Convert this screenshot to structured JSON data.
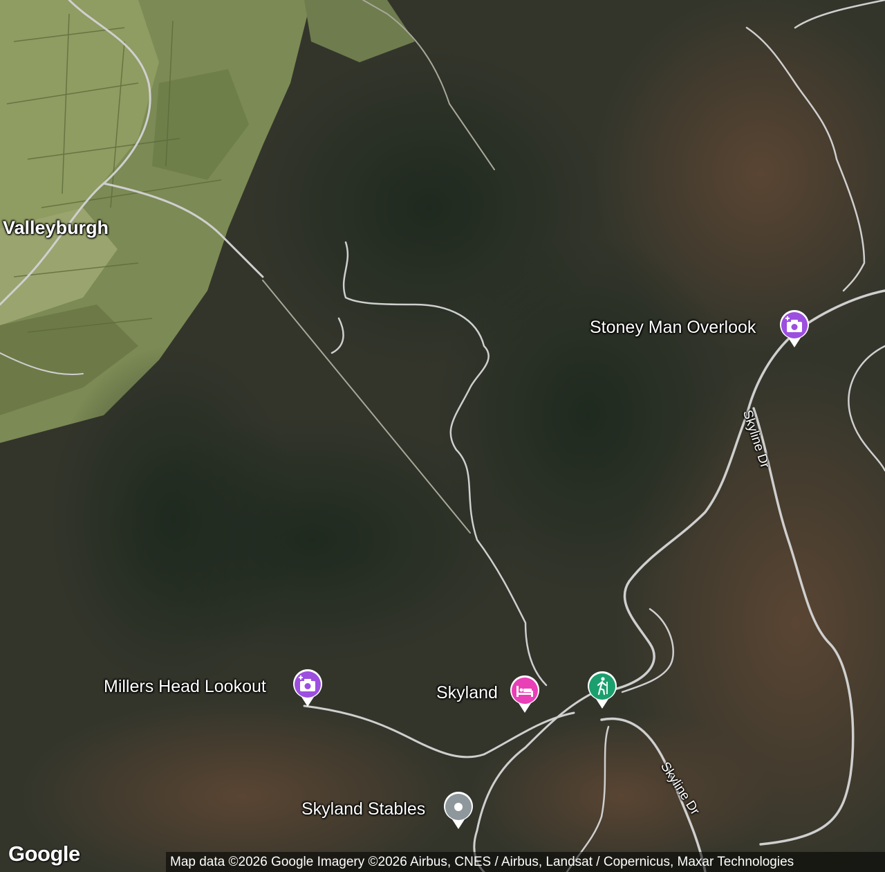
{
  "map": {
    "type": "satellite",
    "colors": {
      "forest_dark": "#2f3429",
      "forest_brown": "#4a3c2e",
      "farmland": "#8a9a5a",
      "road": "#d8d8d8",
      "pin_viewpoint": "#9d4fe0",
      "pin_lodging": "#e93fb7",
      "pin_hiking": "#1b9f6e",
      "pin_generic": "#8d979c"
    },
    "labels": {
      "town": "Valleyburgh",
      "road_1": "Skyline Dr",
      "road_2": "Skyline Dr"
    },
    "pois": [
      {
        "name": "Stoney Man Overlook",
        "icon": "camera-plus-icon",
        "category": "viewpoint"
      },
      {
        "name": "Millers Head Lookout",
        "icon": "camera-plus-icon",
        "category": "viewpoint"
      },
      {
        "name": "Skyland",
        "icon": "bed-icon",
        "category": "lodging"
      },
      {
        "name": "",
        "icon": "hiker-icon",
        "category": "hiking"
      },
      {
        "name": "Skyland Stables",
        "icon": "dot-icon",
        "category": "generic"
      }
    ],
    "branding": {
      "logo": "Google",
      "attribution": "Map data ©2026 Google Imagery ©2026 Airbus, CNES / Airbus, Landsat / Copernicus, Maxar Technologies"
    }
  }
}
